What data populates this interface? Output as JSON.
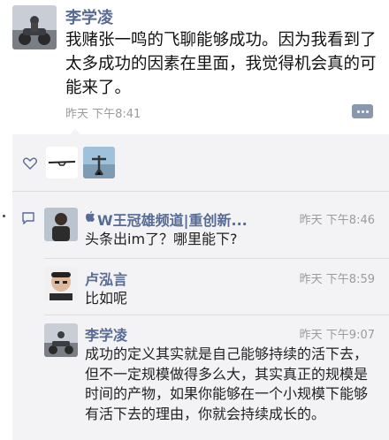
{
  "post": {
    "author": "李学凌",
    "text": "我赌张一鸣的飞聊能够成功。因为我看到了太多成功的因素在里面，我觉得机会真的可能来了。",
    "time": "昨天 下午8:41"
  },
  "comments": [
    {
      "author": "W王冠雄频道|重创新...",
      "time": "昨天 下午8:46",
      "text": "头条出im了？哪里能下?"
    },
    {
      "author": "卢泓言",
      "time": "昨天 下午8:59",
      "text": "比如呢"
    },
    {
      "author": "李学凌",
      "time": "昨天 下午9:07",
      "text": "成功的定义其实就是自己能够持续的活下去，但不一定规模做得多么大，其实真正的规模是时间的产物，如果你能够在一个小规模下能够有活下去的理由，你就会持续成长的。"
    }
  ],
  "colors": {
    "name": "#576b95",
    "panel": "#f3f3f5",
    "time": "#9b9b9b"
  },
  "icons": {
    "like": "heart-icon",
    "comment": "comment-icon",
    "more": "more-dots-icon",
    "apple": "apple-icon"
  }
}
